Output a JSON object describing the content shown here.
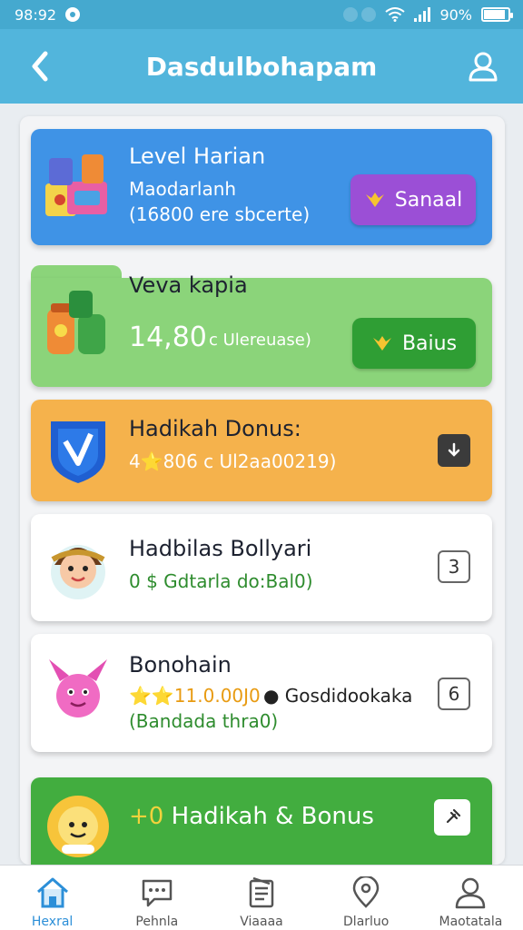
{
  "status_bar": {
    "time": "98:92",
    "battery": "90%",
    "battery_level": 0.9
  },
  "header": {
    "title": "Dasdulbohapam"
  },
  "cards": {
    "daily": {
      "title": "Level Harian",
      "line1": "Maodarlanh",
      "line2": "(16800 ere sbcerte)",
      "button": "Sanaal"
    },
    "green": {
      "title": "Veva kapia",
      "value": "14,80",
      "unit": "c Ulereuase)",
      "button": "Baius"
    },
    "orange": {
      "title": "Hadikah Donus:",
      "line1": "4⭐806 c Ul2aa00219)"
    },
    "white1": {
      "title": "Hadbilas Bollyari",
      "line1": "0 $ Gdtarla do:Bal0)",
      "badge": "3"
    },
    "white2": {
      "title": "Bonohain",
      "gold": "⭐⭐11.0.00J0",
      "dark": "● Gosdidookaka",
      "line2": "(Bandada thra0)",
      "badge": "6"
    },
    "bottom": {
      "title": "Hadikah & Bonus",
      "prefix": "+0"
    }
  },
  "bottom_nav": {
    "items": [
      {
        "label": "Hexral",
        "icon": "home-icon"
      },
      {
        "label": "Pehnla",
        "icon": "chat-icon"
      },
      {
        "label": "Viaaaa",
        "icon": "clipboard-icon"
      },
      {
        "label": "Dlarluo",
        "icon": "location-pin-icon"
      },
      {
        "label": "Maotatala",
        "icon": "person-icon"
      }
    ],
    "active_index": 0
  },
  "colors": {
    "app_bar": "#52b5dc",
    "card_blue": "#3f93e6",
    "card_green": "#8bd47a",
    "card_orange": "#f5b24c",
    "card_bottom": "#42ad3f",
    "button_purple": "#9b4fd6",
    "button_green": "#2f9e34",
    "nav_active": "#2c8fd8"
  }
}
